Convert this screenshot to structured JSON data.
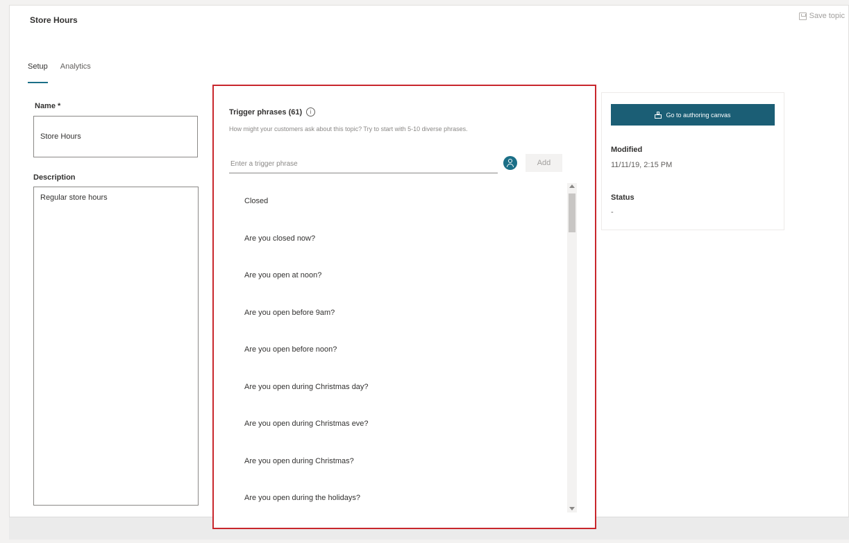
{
  "page": {
    "title": "Store Hours",
    "save_label": "Save topic"
  },
  "tabs": [
    {
      "label": "Setup",
      "active": true
    },
    {
      "label": "Analytics",
      "active": false
    }
  ],
  "name_field": {
    "label": "Name *",
    "value": "Store Hours"
  },
  "description_field": {
    "label": "Description",
    "value": "Regular store hours"
  },
  "trigger_phrases": {
    "title": "Trigger phrases (61)",
    "help_text": "How might your customers ask about this topic? Try to start with 5-10 diverse phrases.",
    "input_placeholder": "Enter a trigger phrase",
    "add_label": "Add",
    "items": [
      "Closed",
      "Are you closed now?",
      "Are you open at noon?",
      "Are you open before 9am?",
      "Are you open before noon?",
      "Are you open during Christmas day?",
      "Are you open during Christmas eve?",
      "Are you open during Christmas?",
      "Are you open during the holidays?"
    ]
  },
  "details": {
    "canvas_button_label": "Go to authoring canvas",
    "modified_label": "Modified",
    "modified_value": "11/11/19, 2:15 PM",
    "status_label": "Status",
    "status_value": "-"
  },
  "colors": {
    "accent": "#1b6f87",
    "highlight_border": "#c8262c"
  }
}
